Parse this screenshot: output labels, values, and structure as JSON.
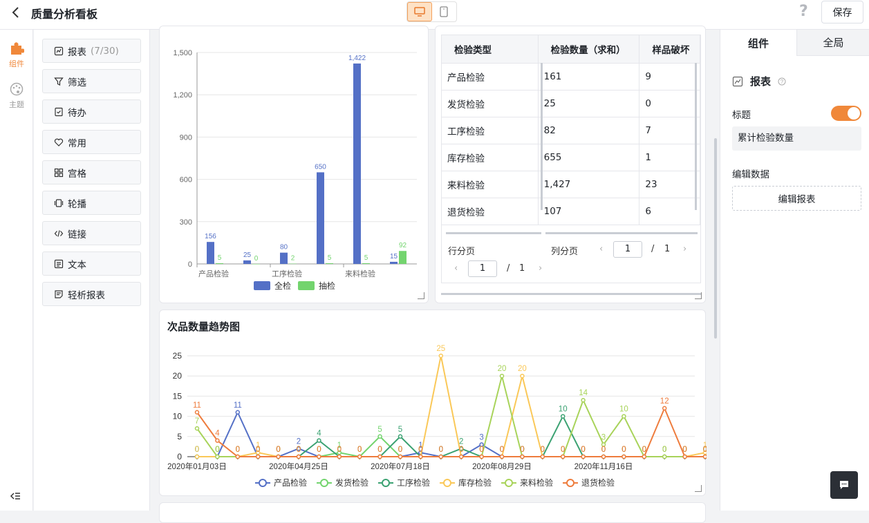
{
  "header": {
    "title": "质量分析看板",
    "save_label": "保存",
    "help_label": "?"
  },
  "left_rail": {
    "items": [
      {
        "label": "组件",
        "icon": "puzzle-icon",
        "active": true
      },
      {
        "label": "主题",
        "icon": "palette-icon",
        "active": false
      }
    ]
  },
  "palette": {
    "items": [
      {
        "label": "报表",
        "count": "(7/30)",
        "icon": "chart-icon"
      },
      {
        "label": "筛选",
        "icon": "filter-icon"
      },
      {
        "label": "待办",
        "icon": "todo-icon"
      },
      {
        "label": "常用",
        "icon": "heart-icon"
      },
      {
        "label": "宫格",
        "icon": "grid-icon"
      },
      {
        "label": "轮播",
        "icon": "carousel-icon"
      },
      {
        "label": "链接",
        "icon": "code-icon"
      },
      {
        "label": "文本",
        "icon": "text-icon"
      },
      {
        "label": "轻析报表",
        "icon": "report-icon"
      }
    ]
  },
  "table": {
    "headers": [
      "检验类型",
      "检验数量（求和）",
      "样品破坏"
    ],
    "rows": [
      [
        "产品检验",
        "161",
        "9"
      ],
      [
        "发货检验",
        "25",
        "0"
      ],
      [
        "工序检验",
        "82",
        "7"
      ],
      [
        "库存检验",
        "655",
        "1"
      ],
      [
        "来料检验",
        "1,427",
        "23"
      ],
      [
        "退货检验",
        "107",
        "6"
      ]
    ],
    "row_pager_label": "行分页",
    "col_pager_label": "列分页",
    "row_page": "1",
    "row_total": "1",
    "col_page": "1",
    "col_total": "1",
    "slash": "/"
  },
  "right_panel": {
    "tabs": [
      "组件",
      "全局"
    ],
    "section_title": "报表",
    "title_label": "标题",
    "title_value": "累计检验数量",
    "edit_data_label": "编辑数据",
    "edit_table_button": "编辑报表"
  },
  "chart_data": [
    {
      "type": "bar",
      "categories": [
        "产品检验",
        "发货检验",
        "工序检验",
        "库存检验",
        "来料检验",
        "退货检验"
      ],
      "x_tick_labels": [
        "产品检验",
        "",
        "工序检验",
        "",
        "来料检验",
        ""
      ],
      "series": [
        {
          "name": "全检",
          "color": "#5470c6",
          "values": [
            156,
            25,
            80,
            650,
            1422,
            15
          ]
        },
        {
          "name": "抽检",
          "color": "#73d46e",
          "values": [
            5,
            0,
            2,
            5,
            5,
            92
          ]
        }
      ],
      "data_labels": [
        [
          "156",
          "25",
          "80",
          "650",
          "1,422",
          "15"
        ],
        [
          "5",
          "0",
          "2",
          "5",
          "5",
          "92"
        ]
      ],
      "ylim": [
        0,
        1500
      ],
      "yticks": [
        "0",
        "300",
        "600",
        "900",
        "1,200",
        "1,500"
      ],
      "legend": "bottom",
      "grid": true
    },
    {
      "type": "line",
      "title": "次品数量趋势图",
      "x_tick_labels": [
        "2020年01月03日",
        "2020年04月25日",
        "2020年07月18日",
        "2020年08月29日",
        "2020年11月16日"
      ],
      "ylim": [
        0,
        25
      ],
      "yticks": [
        "0",
        "5",
        "10",
        "15",
        "20",
        "25"
      ],
      "legend": "bottom",
      "grid": true,
      "series": [
        {
          "name": "产品检验",
          "color": "#5470c6",
          "values": [
            0,
            0,
            11,
            0,
            0,
            2,
            0,
            0,
            0,
            0,
            0,
            1,
            0,
            0,
            3,
            0,
            0,
            0,
            0,
            0,
            0,
            0,
            0,
            0,
            0,
            0,
            0
          ]
        },
        {
          "name": "发货检验",
          "color": "#73d46e",
          "values": [
            0,
            0,
            0,
            0,
            0,
            0,
            0,
            1,
            0,
            5,
            0,
            0,
            0,
            0,
            0,
            0,
            0,
            0,
            0,
            0,
            0,
            0,
            0,
            0,
            0,
            0,
            0
          ]
        },
        {
          "name": "工序检验",
          "color": "#3ba272",
          "values": [
            0,
            0,
            0,
            0,
            0,
            0,
            4,
            0,
            0,
            0,
            5,
            0,
            0,
            2,
            0,
            0,
            0,
            0,
            10,
            0,
            0,
            0,
            0,
            0,
            0,
            0,
            0
          ]
        },
        {
          "name": "库存检验",
          "color": "#fac858",
          "values": [
            0,
            0,
            0,
            1,
            0,
            0,
            0,
            0,
            0,
            0,
            0,
            0,
            25,
            0,
            0,
            0,
            20,
            0,
            0,
            0,
            0,
            0,
            0,
            0,
            0,
            1,
            0
          ]
        },
        {
          "name": "来料检验",
          "color": "#a8d35a",
          "values": [
            7,
            0,
            0,
            0,
            0,
            0,
            0,
            0,
            0,
            0,
            0,
            0,
            0,
            0,
            0,
            20,
            0,
            0,
            0,
            14,
            3,
            10,
            0,
            0,
            0,
            0,
            0
          ]
        },
        {
          "name": "退货检验",
          "color": "#ee7c3d",
          "values": [
            11,
            4,
            0,
            0,
            0,
            0,
            0,
            0,
            0,
            0,
            0,
            0,
            0,
            0,
            0,
            0,
            0,
            0,
            0,
            0,
            0,
            0,
            0,
            12,
            0,
            0,
            0
          ]
        }
      ]
    }
  ]
}
